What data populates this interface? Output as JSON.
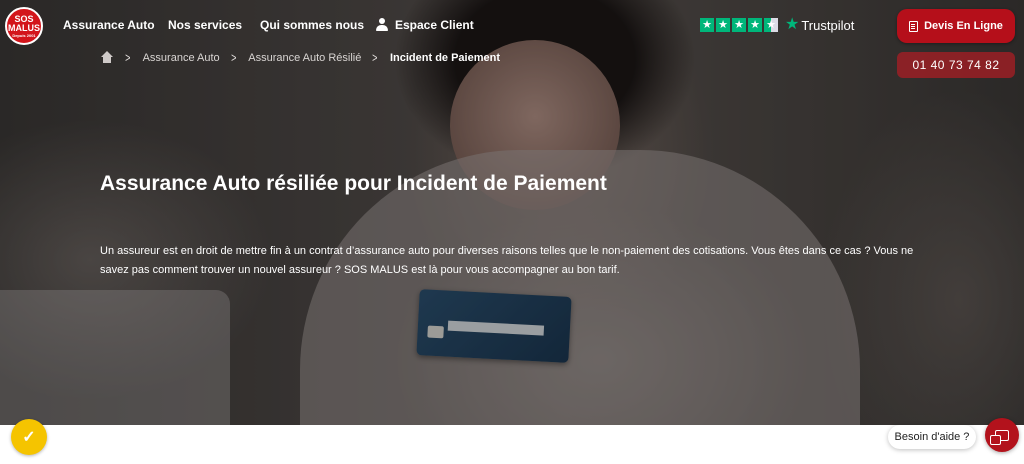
{
  "header": {
    "logo": {
      "line1": "SOS",
      "line2": "MALUS",
      "line3": "Depuis 2001"
    },
    "nav": [
      {
        "label": "Assurance Auto"
      },
      {
        "label": "Nos services"
      },
      {
        "label": "Qui sommes nous"
      },
      {
        "label": "Espace Client",
        "icon": "user-icon"
      }
    ],
    "trustpilot": {
      "label": "Trustpilot",
      "stars": 4.5,
      "color": "#00b67a"
    },
    "cta_label": "Devis En Ligne",
    "phone": "01 40 73 74 82",
    "accent": "#b50f1a"
  },
  "breadcrumb": {
    "items": [
      "Assurance Auto",
      "Assurance Auto Résilié",
      "Incident de Paiement"
    ]
  },
  "hero": {
    "title": "Assurance Auto résiliée pour Incident de Paiement",
    "text": "Un assureur est en droit de mettre fin à un contrat d’assurance auto pour diverses raisons telles que le non-paiement des cotisations. Vous êtes dans ce cas ? Vous ne savez pas comment trouver un nouvel assureur ? SOS MALUS est là pour vous accompagner au bon tarif."
  },
  "widgets": {
    "help_label": "Besoin d'aide ?",
    "left_badge_icon": "checkmark-badge-icon",
    "chat_icon": "chat-icon"
  }
}
